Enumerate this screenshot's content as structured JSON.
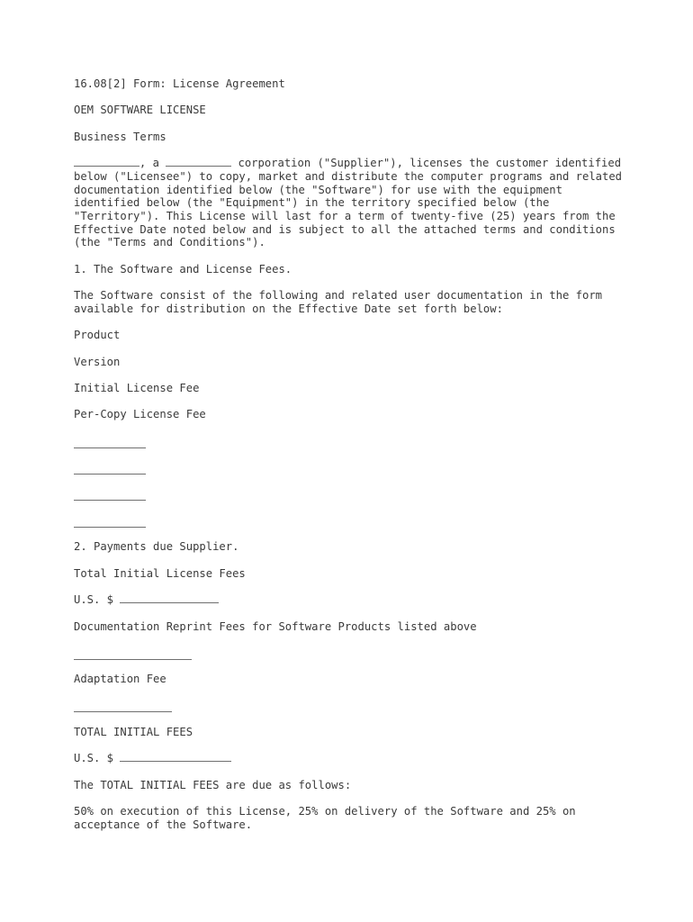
{
  "document": {
    "citation": "16.08[2] Form: License Agreement",
    "title": "OEM SOFTWARE LICENSE",
    "subtitle": "Business Terms",
    "preamble": {
      "before_first_blank": "",
      "after_first_blank": ", a ",
      "after_second_blank": " corporation (\"Supplier\"), licenses the customer identified below (\"Licensee\") to copy, market and distribute the computer programs and related documentation identified below (the \"Software\") for use with the equipment identified below (the \"Equipment\") in the territory specified below (the \"Territory\"). This License will last for a term of twenty-five (25) years from the Effective Date noted below and is subject to all the attached terms and conditions (the \"Terms and Conditions\")."
    },
    "section_1": {
      "heading": "1. The Software and License Fees.",
      "intro": "The Software consist of the following and related user documentation in the form available for distribution on the Effective Date set forth below:",
      "fields": [
        "Product",
        "Version",
        "Initial License Fee",
        "Per-Copy License Fee"
      ],
      "blank_rules": [
        {
          "chars": 11
        },
        {
          "chars": 11
        },
        {
          "chars": 11
        },
        {
          "chars": 11
        }
      ]
    },
    "section_2": {
      "heading": "2. Payments due Supplier.",
      "total_initial_license_fees_label": "Total Initial License Fees",
      "total_initial_license_fees_currency": "U.S. $",
      "total_initial_license_fees_blank_chars": 15,
      "documentation_reprint_label": "Documentation Reprint Fees for Software Products listed above",
      "documentation_reprint_blank_chars": 18,
      "adaptation_fee_label": "Adaptation Fee",
      "adaptation_fee_blank_chars": 15,
      "total_initial_fees_label": "TOTAL INITIAL FEES",
      "total_initial_fees_currency": "U.S. $",
      "total_initial_fees_blank_chars": 17,
      "due_intro": "The TOTAL INITIAL FEES are due as follows:",
      "due_terms": "50% on execution of this License, 25% on delivery of the Software and 25% on acceptance of the Software."
    },
    "inline_blank_chars": 10,
    "text_color": "#3a3a3a",
    "rule_color": "#6f6f6f",
    "background_color": "#ffffff"
  }
}
